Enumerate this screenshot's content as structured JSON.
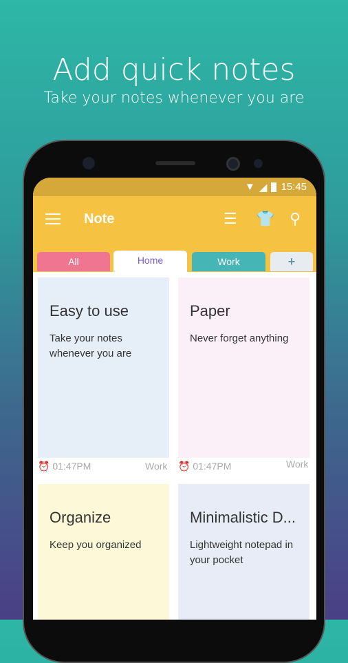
{
  "hero": {
    "title": "Add quick notes",
    "subtitle": "Take your notes whenever you are"
  },
  "status": {
    "time": "15:45"
  },
  "appbar": {
    "title": "Note",
    "icons": [
      "menu-icon",
      "list-view-icon",
      "theme-shirt-icon",
      "search-icon"
    ]
  },
  "tabs": [
    {
      "label": "All",
      "color": "#f07590"
    },
    {
      "label": "Home",
      "color": "#ffffff"
    },
    {
      "label": "Work",
      "color": "#45b5b5"
    },
    {
      "label": "+",
      "color": "#e6ecef"
    }
  ],
  "notes": [
    {
      "title": "Easy to use",
      "body": "Take your notes whenever you are",
      "time": "01:47PM",
      "tag": "Work",
      "color": "#e6eef8"
    },
    {
      "title": "Paper",
      "body": "Never forget anything",
      "time": "01:47PM",
      "tag": "Work",
      "color": "#fbf0f8"
    },
    {
      "title": "Organize",
      "body": "Keep you organized",
      "color": "#fdf9d8"
    },
    {
      "title": "Minimalistic D...",
      "body": "Lightweight notepad in your pocket",
      "color": "#e8ecf6"
    }
  ]
}
